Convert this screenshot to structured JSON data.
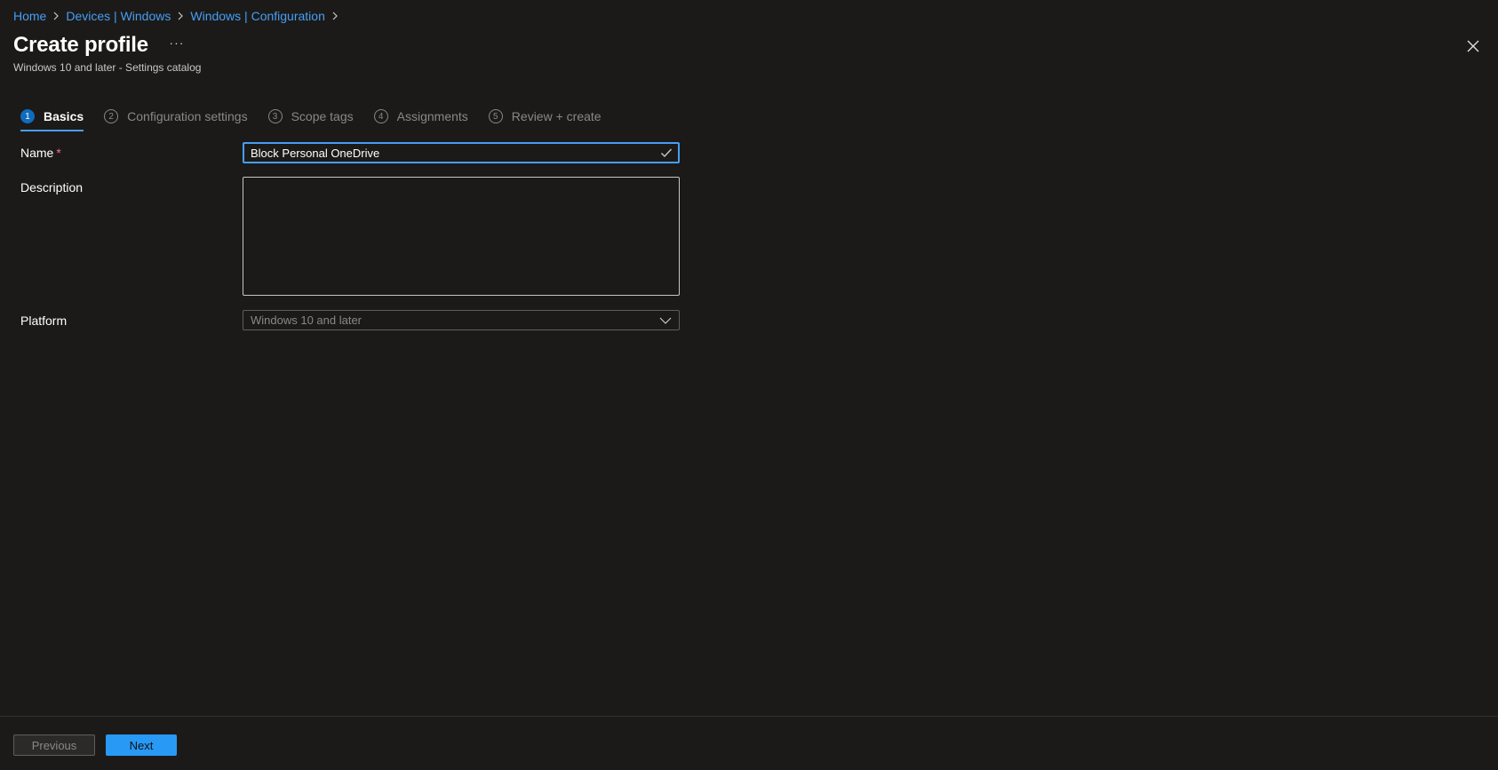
{
  "breadcrumb": [
    {
      "label": "Home"
    },
    {
      "label": "Devices | Windows"
    },
    {
      "label": "Windows | Configuration"
    }
  ],
  "header": {
    "title": "Create profile",
    "more_label": "···",
    "subtitle": "Windows 10 and later - Settings catalog"
  },
  "wizard": {
    "steps": [
      {
        "num": "1",
        "label": "Basics",
        "active": true
      },
      {
        "num": "2",
        "label": "Configuration settings",
        "active": false
      },
      {
        "num": "3",
        "label": "Scope tags",
        "active": false
      },
      {
        "num": "4",
        "label": "Assignments",
        "active": false
      },
      {
        "num": "5",
        "label": "Review + create",
        "active": false
      }
    ]
  },
  "form": {
    "name_label": "Name",
    "required_marker": "*",
    "name_value": "Block Personal OneDrive",
    "description_label": "Description",
    "description_value": "",
    "platform_label": "Platform",
    "platform_value": "Windows 10 and later"
  },
  "footer": {
    "previous_label": "Previous",
    "next_label": "Next"
  },
  "colors": {
    "background": "#1b1a19",
    "link": "#479ef5",
    "accent": "#0f6cbd",
    "primary_button": "#2899f5",
    "required": "#f1707b"
  }
}
